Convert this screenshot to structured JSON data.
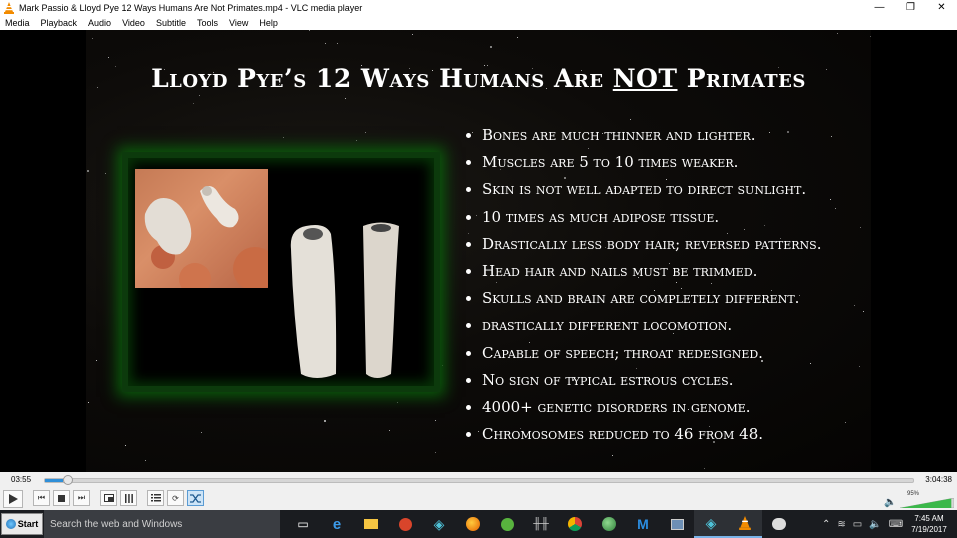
{
  "window": {
    "title": "Mark Passio & Lloyd Pye 12 Ways Humans Are Not Primates.mp4 - VLC media player",
    "minimize_glyph": "—",
    "maximize_glyph": "❐",
    "close_glyph": "✕"
  },
  "menu": [
    "Media",
    "Playback",
    "Audio",
    "Video",
    "Subtitle",
    "Tools",
    "View",
    "Help"
  ],
  "slide": {
    "title_part1": "Lloyd Pye’s 12 Ways Humans Are ",
    "title_emphasis": "NOT",
    "title_part2": " Primates",
    "bullets": [
      "Bones are much thinner and lighter.",
      "Muscles are 5 to 10 times weaker.",
      "Skin is not well adapted to direct sunlight.",
      "10 times as much adipose tissue.",
      "Drastically less body hair; reversed patterns.",
      "Head hair and nails must be trimmed.",
      "Skulls and brain are completely different.",
      "drastically different locomotion.",
      "Capable of speech; throat redesigned.",
      "No sign of typical estrous cycles.",
      "4000+ genetic disorders in genome.",
      "Chromosomes reduced to 46 from 48."
    ]
  },
  "player": {
    "elapsed": "03:55",
    "total": "3:04:38",
    "progress_fraction": 0.021,
    "volume_label": "95%",
    "volume_fraction": 0.95,
    "accent_color": "#2f8fd8"
  },
  "taskbar": {
    "start_label": "Start",
    "search_placeholder": "Search the web and Windows",
    "clock_time": "7:45 AM",
    "clock_date": "7/19/2017"
  }
}
